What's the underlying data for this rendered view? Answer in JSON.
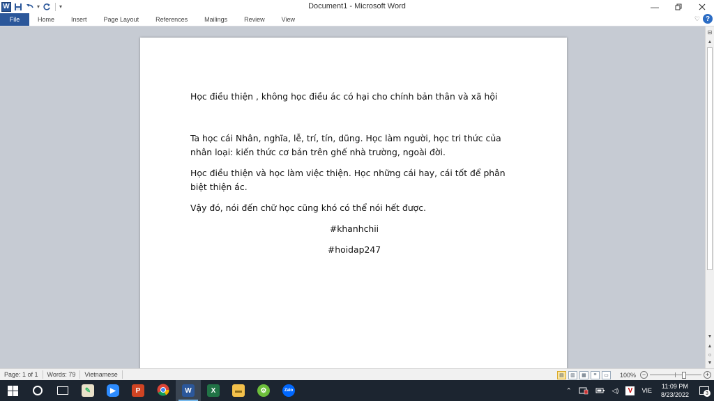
{
  "window": {
    "title": "Document1  -  Microsoft Word",
    "app_icon": "word-icon"
  },
  "quick_access": {
    "items": [
      "save-icon",
      "undo-icon",
      "redo-icon",
      "customize-dropdown-icon"
    ]
  },
  "ribbon": {
    "file_tab": "File",
    "tabs": [
      "Home",
      "Insert",
      "Page Layout",
      "References",
      "Mailings",
      "Review",
      "View"
    ],
    "help_label": "?"
  },
  "document": {
    "paragraphs": [
      "Học điều thiện , không học điều ác có hại cho chính bản thân và xã hội",
      "",
      "Ta học cái Nhân, nghĩa, lễ, trí, tín, dũng. Học làm người, học tri thức của nhân loại: kiến thức cơ bản trên ghế nhà trường, ngoài đời.",
      "Học điều thiện và học làm việc thiện. Học những cái hay, cái tốt để phân biệt thiện ác.",
      "Vậy đó, nói đến chữ học cũng khó có thể nói hết được.",
      "#khanhchii",
      " #hoidap247"
    ]
  },
  "statusbar": {
    "page": "Page: 1 of 1",
    "words": "Words: 79",
    "language": "Vietnamese",
    "zoom": "100%",
    "zoom_minus": "−",
    "zoom_plus": "+",
    "zoom_level_percent": 100
  },
  "taskbar": {
    "apps": [
      "start-icon",
      "search-icon",
      "task-view-icon",
      "paint-icon",
      "zoom-icon",
      "powerpoint-icon",
      "chrome-icon",
      "word-icon",
      "excel-icon",
      "file-explorer-icon",
      "app-icon",
      "zalo-icon"
    ],
    "language": "VIE",
    "time": "11:09 PM",
    "date": "8/23/2022",
    "notification_count": "3",
    "zalo_label": "Zalo"
  },
  "colors": {
    "word_blue": "#2b579a",
    "taskbar": "#1c2530",
    "doc_background": "#c6cbd3"
  }
}
